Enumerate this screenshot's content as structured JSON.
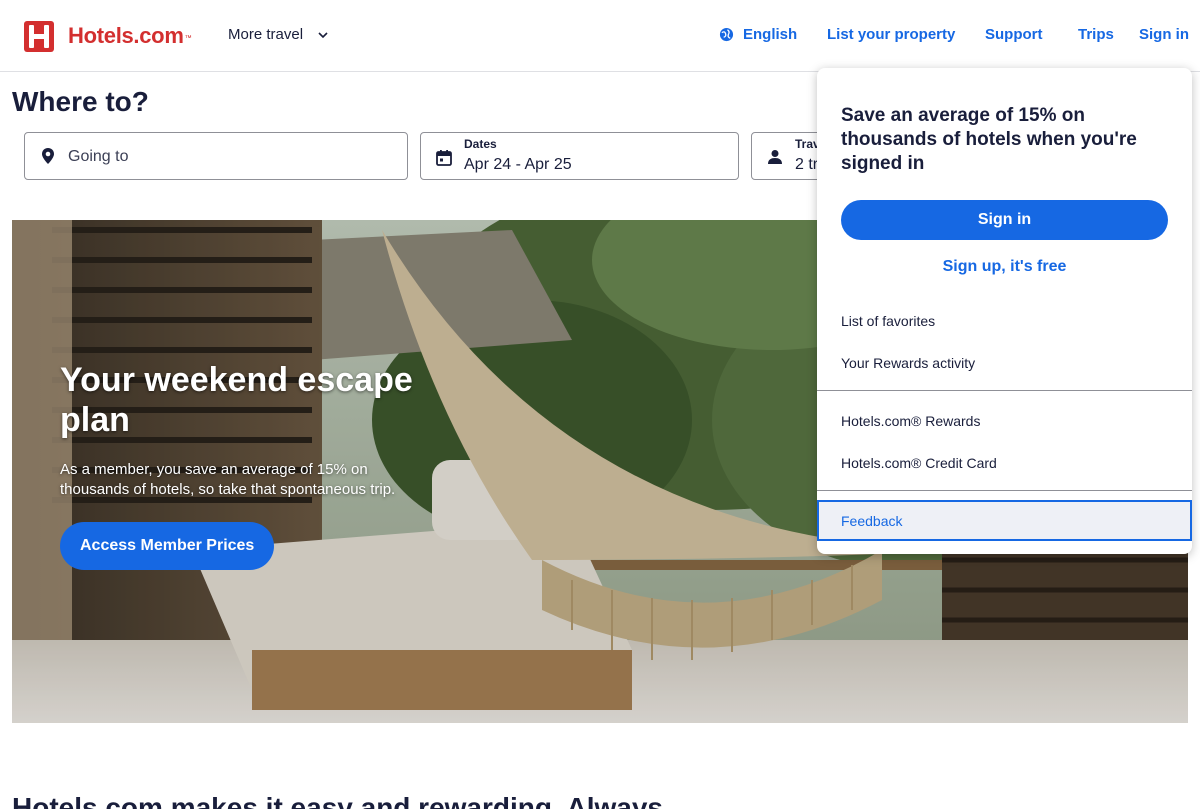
{
  "header": {
    "logo_text": "Hotels.com",
    "logo_tm": "™",
    "more_travel": "More travel",
    "language": "English",
    "list_property": "List your property",
    "support": "Support",
    "trips": "Trips",
    "sign_in": "Sign in"
  },
  "search": {
    "title": "Where to?",
    "going_to_placeholder": "Going to",
    "dates_label": "Dates",
    "dates_value": "Apr 24 - Apr 25",
    "travelers_label": "Trav",
    "travelers_value": "2 tr"
  },
  "hero": {
    "title": "Your weekend escape plan",
    "subtitle": "As a member, you save an average of 15% on thousands of hotels, so take that spontaneous trip.",
    "cta": "Access Member Prices"
  },
  "bottom": {
    "heading": "Hotels.com makes it easy and rewarding. Always."
  },
  "dropdown": {
    "headline": "Save an average of 15% on thousands of hotels when you're signed in",
    "sign_in_button": "Sign in",
    "sign_up_link": "Sign up, it's free",
    "items_group1": [
      "List of favorites",
      "Your Rewards activity"
    ],
    "items_group2": [
      "Hotels.com® Rewards",
      "Hotels.com® Credit Card"
    ],
    "feedback": "Feedback"
  },
  "colors": {
    "brand_red": "#d32f2f",
    "link_blue": "#1668e3",
    "text_dark": "#191e3b",
    "focus_bg": "#eef0f6"
  },
  "icons": {
    "logo": "hotels-logo-icon",
    "chevron": "chevron-down-icon",
    "globe": "globe-icon",
    "location": "location-pin-icon",
    "calendar": "calendar-icon",
    "person": "person-icon"
  }
}
